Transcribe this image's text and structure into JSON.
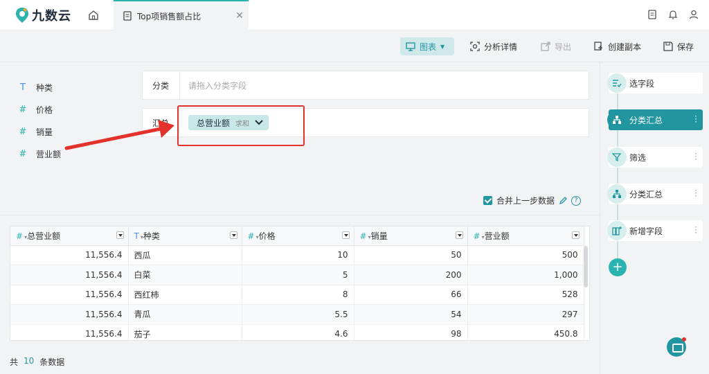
{
  "app": {
    "logo_text": "九数云",
    "tab_title": "Top项销售额占比"
  },
  "toolbar": {
    "chart_label": "图表",
    "analysis_label": "分析详情",
    "export_label": "导出",
    "copy_label": "创建副本",
    "save_label": "保存"
  },
  "fields": [
    {
      "type": "T",
      "label": "种类"
    },
    {
      "type": "#",
      "label": "价格"
    },
    {
      "type": "#",
      "label": "销量"
    },
    {
      "type": "#",
      "label": "营业额"
    }
  ],
  "zones": {
    "category_label": "分类",
    "category_placeholder": "请拖入分类字段",
    "summary_label": "汇总",
    "chip_name": "总营业额",
    "chip_agg": "求和"
  },
  "merge_label": "合并上一步数据",
  "table": {
    "columns": [
      {
        "type": "#",
        "label": "总营业额"
      },
      {
        "type": "T",
        "label": "种类"
      },
      {
        "type": "#",
        "label": "价格"
      },
      {
        "type": "#",
        "label": "销量"
      },
      {
        "type": "#",
        "label": "营业额"
      }
    ],
    "rows": [
      [
        "11,556.4",
        "西瓜",
        "10",
        "50",
        "500"
      ],
      [
        "11,556.4",
        "白菜",
        "5",
        "200",
        "1,000"
      ],
      [
        "11,556.4",
        "西红柿",
        "8",
        "66",
        "528"
      ],
      [
        "11,556.4",
        "青瓜",
        "5.5",
        "54",
        "297"
      ],
      [
        "11,556.4",
        "茄子",
        "4.6",
        "98",
        "450.8"
      ]
    ]
  },
  "footer": {
    "prefix": "共",
    "count": "10",
    "suffix": "条数据"
  },
  "steps": [
    {
      "label": "选字段",
      "active": false
    },
    {
      "label": "分类汇总",
      "active": true
    },
    {
      "label": "筛选",
      "active": false
    },
    {
      "label": "分类汇总",
      "active": false
    },
    {
      "label": "新增字段",
      "active": false
    }
  ],
  "colors": {
    "accent": "#2296a0",
    "accent_light": "#2bb3b0",
    "highlight": "#e5312c"
  }
}
